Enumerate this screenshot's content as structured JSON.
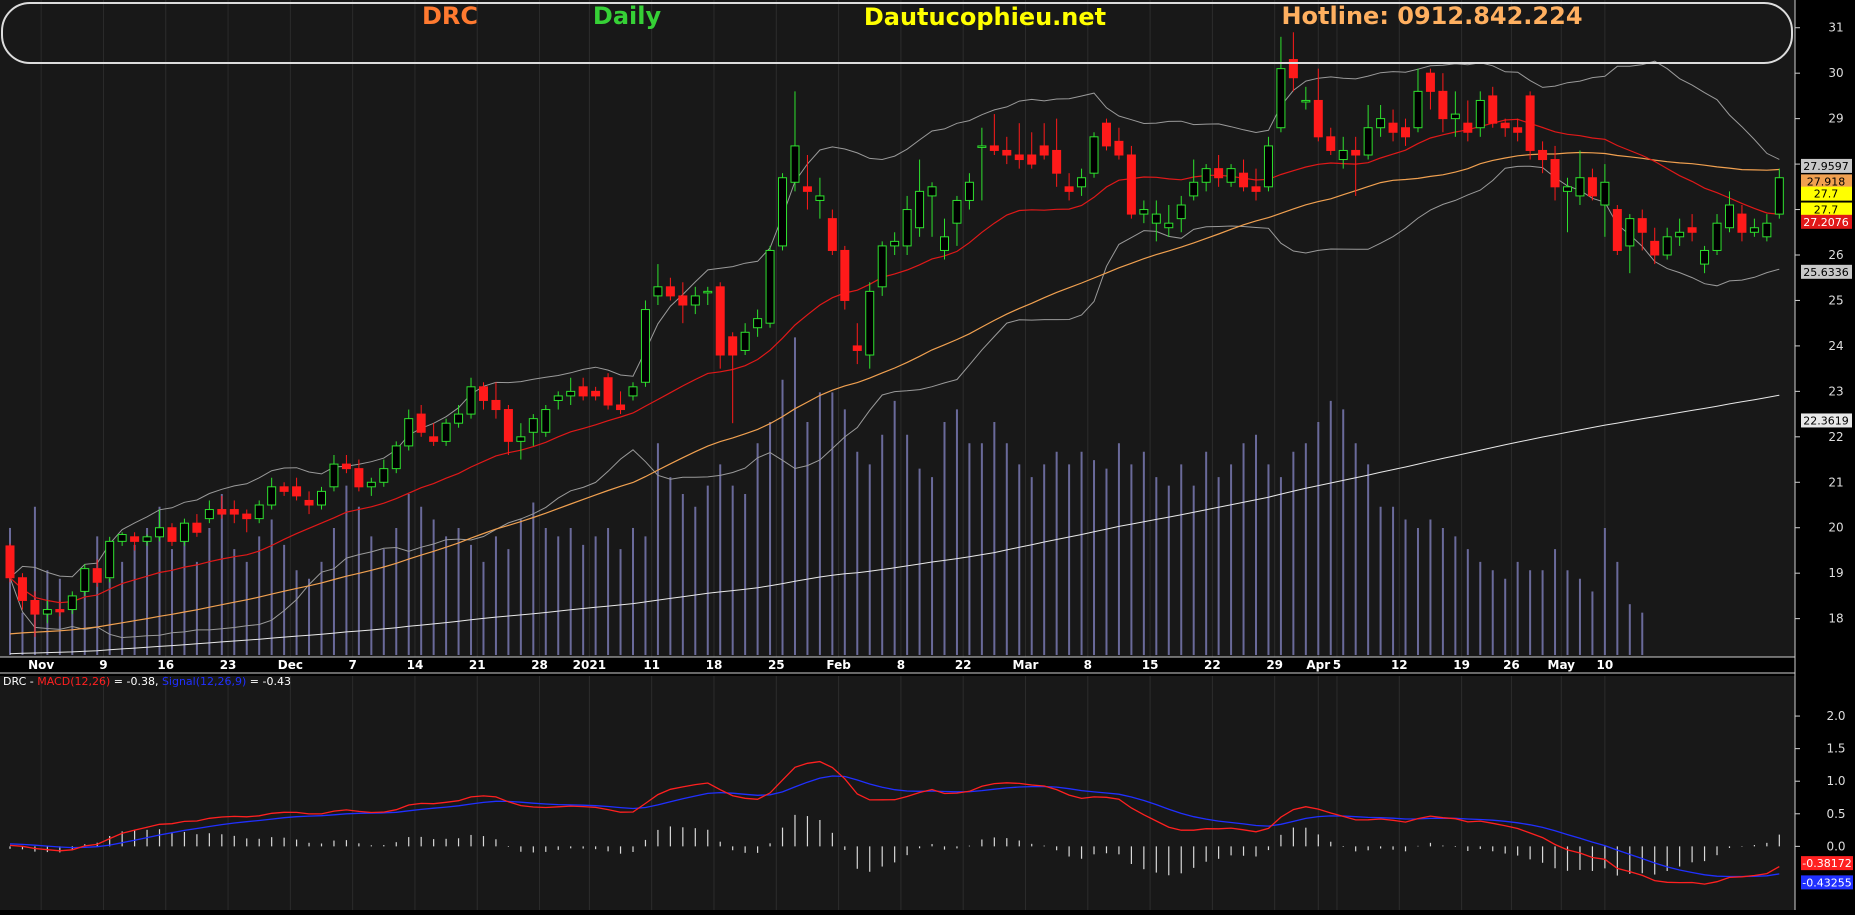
{
  "header": {
    "symbol": "DRC",
    "interval": "Daily",
    "site": "Dautucophieu.net",
    "hotline": "Hotline: 0912.842.224"
  },
  "colors": {
    "up": "#2ee02e",
    "down": "#ff1a1a",
    "ma_short": "#e01818",
    "ma_mid": "#f0a050",
    "ma_long": "#e8e8e8",
    "bands": "#9a9a9a",
    "volume": "#6a6a9a",
    "macd": "#ff2020",
    "signal": "#2030ff",
    "hist": "#d8d8d8",
    "symbol_color": "#ff7a30",
    "interval_color": "#36d036",
    "site_color": "#ffff00",
    "hotline_color": "#ffb060"
  },
  "chart_data": [
    {
      "type": "candlestick",
      "title": "",
      "ylim": [
        17.2,
        31.5
      ],
      "yticks": [
        "18",
        "19",
        "20",
        "21",
        "22",
        "23",
        "24",
        "25",
        "26",
        "27",
        "28",
        "29",
        "30",
        "31"
      ],
      "x_labels": [
        {
          "label": "Nov",
          "session": 2.5
        },
        {
          "label": "9",
          "session": 7.5
        },
        {
          "label": "16",
          "session": 12.5
        },
        {
          "label": "23",
          "session": 17.5
        },
        {
          "label": "Dec",
          "session": 22.5
        },
        {
          "label": "7",
          "session": 27.5
        },
        {
          "label": "14",
          "session": 32.5
        },
        {
          "label": "21",
          "session": 37.5
        },
        {
          "label": "28",
          "session": 42.5
        },
        {
          "label": "2021",
          "session": 46.5
        },
        {
          "label": "11",
          "session": 51.5
        },
        {
          "label": "18",
          "session": 56.5
        },
        {
          "label": "25",
          "session": 61.5
        },
        {
          "label": "Feb",
          "session": 66.5
        },
        {
          "label": "8",
          "session": 71.5
        },
        {
          "label": "22",
          "session": 76.5
        },
        {
          "label": "Mar",
          "session": 81.5
        },
        {
          "label": "8",
          "session": 86.5
        },
        {
          "label": "15",
          "session": 91.5
        },
        {
          "label": "22",
          "session": 96.5
        },
        {
          "label": "29",
          "session": 101.5
        },
        {
          "label": "Apr",
          "session": 105.0
        },
        {
          "label": "5",
          "session": 106.5
        },
        {
          "label": "12",
          "session": 111.5
        },
        {
          "label": "19",
          "session": 116.5
        },
        {
          "label": "26",
          "session": 120.5
        },
        {
          "label": "May",
          "session": 124.5
        },
        {
          "label": "10",
          "session": 128.0
        }
      ],
      "value_tags": [
        {
          "value": "27.9597",
          "color": "#c8c8c8",
          "text_color": "#000000",
          "y": 27.96
        },
        {
          "value": "27.918",
          "color": "#f0a050",
          "text_color": "#000000",
          "y": 27.62
        },
        {
          "value": "27.7",
          "color": "#ffff00",
          "text_color": "#000000",
          "y": 27.35
        },
        {
          "value": "27.7",
          "color": "#ffff00",
          "text_color": "#000000",
          "y": 27.0
        },
        {
          "value": "27.2076",
          "color": "#e01818",
          "text_color": "#ffffff",
          "y": 26.73
        },
        {
          "value": "25.6336",
          "color": "#c8c8c8",
          "text_color": "#000000",
          "y": 25.63
        },
        {
          "value": "22.3619",
          "color": "#e8e8e8",
          "text_color": "#000000",
          "y": 22.36
        }
      ],
      "candles": [
        [
          19.6,
          19.65,
          18.8,
          18.9
        ],
        [
          18.9,
          19.0,
          18.2,
          18.4
        ],
        [
          18.4,
          18.6,
          17.6,
          18.1
        ],
        [
          18.1,
          18.4,
          17.9,
          18.2
        ],
        [
          18.2,
          18.4,
          18.05,
          18.15
        ],
        [
          18.2,
          18.6,
          18.1,
          18.5
        ],
        [
          18.6,
          19.2,
          18.5,
          19.1
        ],
        [
          19.1,
          19.3,
          18.7,
          18.8
        ],
        [
          18.9,
          19.8,
          18.8,
          19.7
        ],
        [
          19.7,
          19.9,
          19.6,
          19.85
        ],
        [
          19.8,
          19.9,
          19.5,
          19.7
        ],
        [
          19.7,
          19.85,
          19.6,
          19.8
        ],
        [
          19.8,
          20.4,
          19.7,
          20.0
        ],
        [
          20.0,
          20.1,
          19.6,
          19.7
        ],
        [
          19.7,
          20.2,
          19.6,
          20.1
        ],
        [
          20.1,
          20.3,
          19.8,
          19.9
        ],
        [
          20.2,
          20.6,
          20.1,
          20.4
        ],
        [
          20.4,
          20.7,
          20.2,
          20.3
        ],
        [
          20.4,
          20.6,
          20.1,
          20.3
        ],
        [
          20.3,
          20.4,
          19.9,
          20.2
        ],
        [
          20.2,
          20.6,
          20.1,
          20.5
        ],
        [
          20.5,
          21.1,
          20.4,
          20.9
        ],
        [
          20.9,
          21.0,
          20.7,
          20.8
        ],
        [
          20.9,
          21.1,
          20.6,
          20.7
        ],
        [
          20.6,
          20.8,
          20.3,
          20.5
        ],
        [
          20.5,
          20.9,
          20.4,
          20.8
        ],
        [
          20.9,
          21.6,
          20.8,
          21.4
        ],
        [
          21.4,
          21.6,
          21.2,
          21.3
        ],
        [
          21.3,
          21.5,
          20.8,
          20.9
        ],
        [
          20.9,
          21.1,
          20.7,
          21.0
        ],
        [
          21.0,
          21.5,
          20.9,
          21.3
        ],
        [
          21.3,
          21.9,
          21.2,
          21.8
        ],
        [
          21.8,
          22.6,
          21.7,
          22.4
        ],
        [
          22.5,
          22.7,
          22.0,
          22.1
        ],
        [
          22.0,
          22.3,
          21.8,
          21.9
        ],
        [
          21.9,
          22.4,
          21.8,
          22.3
        ],
        [
          22.3,
          22.7,
          22.2,
          22.5
        ],
        [
          22.5,
          23.3,
          22.4,
          23.1
        ],
        [
          23.1,
          23.2,
          22.6,
          22.8
        ],
        [
          22.8,
          23.2,
          22.4,
          22.6
        ],
        [
          22.6,
          22.7,
          21.6,
          21.9
        ],
        [
          21.9,
          22.3,
          21.5,
          22.0
        ],
        [
          22.1,
          22.5,
          21.8,
          22.4
        ],
        [
          22.1,
          22.7,
          22.0,
          22.6
        ],
        [
          22.8,
          23.0,
          22.6,
          22.9
        ],
        [
          22.9,
          23.3,
          22.7,
          23.0
        ],
        [
          23.1,
          23.3,
          22.8,
          22.9
        ],
        [
          23.0,
          23.1,
          22.8,
          22.9
        ],
        [
          23.3,
          23.4,
          22.6,
          22.7
        ],
        [
          22.7,
          23.0,
          22.5,
          22.6
        ],
        [
          22.9,
          23.2,
          22.8,
          23.1
        ],
        [
          23.2,
          25.0,
          23.1,
          24.8
        ],
        [
          25.1,
          25.8,
          24.9,
          25.3
        ],
        [
          25.3,
          25.5,
          25.0,
          25.1
        ],
        [
          25.1,
          25.4,
          24.5,
          24.9
        ],
        [
          24.9,
          25.3,
          24.7,
          25.1
        ],
        [
          25.2,
          25.3,
          24.9,
          25.2
        ],
        [
          25.3,
          25.4,
          23.5,
          23.8
        ],
        [
          24.2,
          24.3,
          22.3,
          23.8
        ],
        [
          23.9,
          24.5,
          23.8,
          24.3
        ],
        [
          24.4,
          24.8,
          24.2,
          24.6
        ],
        [
          24.5,
          26.2,
          24.4,
          26.1
        ],
        [
          26.2,
          27.8,
          26.1,
          27.7
        ],
        [
          27.6,
          29.6,
          27.4,
          28.4
        ],
        [
          27.5,
          28.2,
          27.0,
          27.4
        ],
        [
          27.2,
          27.7,
          26.8,
          27.3
        ],
        [
          26.8,
          27.0,
          26.0,
          26.1
        ],
        [
          26.1,
          26.2,
          24.8,
          25.0
        ],
        [
          24.0,
          24.5,
          23.6,
          23.9
        ],
        [
          23.8,
          25.4,
          23.5,
          25.2
        ],
        [
          25.3,
          26.3,
          25.1,
          26.2
        ],
        [
          26.2,
          26.5,
          26.0,
          26.3
        ],
        [
          26.2,
          27.3,
          26.0,
          27.0
        ],
        [
          26.6,
          28.1,
          26.4,
          27.4
        ],
        [
          27.3,
          27.6,
          26.4,
          27.5
        ],
        [
          26.1,
          26.8,
          25.9,
          26.4
        ],
        [
          26.7,
          27.3,
          26.2,
          27.2
        ],
        [
          27.2,
          27.8,
          27.0,
          27.6
        ],
        [
          28.4,
          28.8,
          27.2,
          28.4
        ],
        [
          28.4,
          29.1,
          28.2,
          28.3
        ],
        [
          28.3,
          28.6,
          28.0,
          28.2
        ],
        [
          28.2,
          28.9,
          27.9,
          28.1
        ],
        [
          28.2,
          28.7,
          27.9,
          28.0
        ],
        [
          28.4,
          28.9,
          28.1,
          28.2
        ],
        [
          28.3,
          29.0,
          27.5,
          27.8
        ],
        [
          27.5,
          27.8,
          27.2,
          27.4
        ],
        [
          27.5,
          27.9,
          27.3,
          27.7
        ],
        [
          27.8,
          28.7,
          27.7,
          28.6
        ],
        [
          28.9,
          29.0,
          28.3,
          28.4
        ],
        [
          28.5,
          28.8,
          28.1,
          28.2
        ],
        [
          28.2,
          28.4,
          26.8,
          26.9
        ],
        [
          26.9,
          27.2,
          26.7,
          27.0
        ],
        [
          26.7,
          27.2,
          26.3,
          26.9
        ],
        [
          26.6,
          27.1,
          26.4,
          26.7
        ],
        [
          26.8,
          27.3,
          26.5,
          27.1
        ],
        [
          27.3,
          28.1,
          27.2,
          27.6
        ],
        [
          27.6,
          28.0,
          27.4,
          27.9
        ],
        [
          27.9,
          28.2,
          27.5,
          27.7
        ],
        [
          27.6,
          28.0,
          27.5,
          27.9
        ],
        [
          27.8,
          28.1,
          27.4,
          27.5
        ],
        [
          27.5,
          27.9,
          27.2,
          27.4
        ],
        [
          27.5,
          28.6,
          27.4,
          28.4
        ],
        [
          28.8,
          30.8,
          28.7,
          30.1
        ],
        [
          30.3,
          30.9,
          29.6,
          29.9
        ],
        [
          29.4,
          29.7,
          29.2,
          29.4
        ],
        [
          29.4,
          30.1,
          28.5,
          28.6
        ],
        [
          28.6,
          28.8,
          28.2,
          28.3
        ],
        [
          28.1,
          28.6,
          27.9,
          28.3
        ],
        [
          28.3,
          28.6,
          27.3,
          28.2
        ],
        [
          28.2,
          29.3,
          28.1,
          28.8
        ],
        [
          28.8,
          29.3,
          28.6,
          29.0
        ],
        [
          28.9,
          29.2,
          28.5,
          28.7
        ],
        [
          28.8,
          29.0,
          28.4,
          28.6
        ],
        [
          28.8,
          30.1,
          28.7,
          29.6
        ],
        [
          30.0,
          30.1,
          29.2,
          29.6
        ],
        [
          29.6,
          30.0,
          28.7,
          29.0
        ],
        [
          29.0,
          29.6,
          28.6,
          29.1
        ],
        [
          28.9,
          29.4,
          28.5,
          28.7
        ],
        [
          28.8,
          29.6,
          28.6,
          29.4
        ],
        [
          29.5,
          29.7,
          28.8,
          28.9
        ],
        [
          28.9,
          29.0,
          28.6,
          28.8
        ],
        [
          28.8,
          29.0,
          28.5,
          28.7
        ],
        [
          29.5,
          29.6,
          28.1,
          28.3
        ],
        [
          28.3,
          28.5,
          27.8,
          28.1
        ],
        [
          28.1,
          28.4,
          27.2,
          27.5
        ],
        [
          27.4,
          27.7,
          26.5,
          27.5
        ],
        [
          27.3,
          28.3,
          27.1,
          27.7
        ],
        [
          27.7,
          27.9,
          27.2,
          27.3
        ],
        [
          27.1,
          28.0,
          26.4,
          27.6
        ],
        [
          27.0,
          27.1,
          26.0,
          26.1
        ],
        [
          26.2,
          26.9,
          25.6,
          26.8
        ],
        [
          26.8,
          27.0,
          26.1,
          26.5
        ],
        [
          26.3,
          26.6,
          25.8,
          26.0
        ],
        [
          26.0,
          26.6,
          25.9,
          26.4
        ],
        [
          26.4,
          26.8,
          26.2,
          26.5
        ],
        [
          26.6,
          26.9,
          26.3,
          26.5
        ],
        [
          25.8,
          26.2,
          25.6,
          26.1
        ],
        [
          26.1,
          26.9,
          26.0,
          26.7
        ],
        [
          26.6,
          27.4,
          26.5,
          27.1
        ],
        [
          26.9,
          27.1,
          26.3,
          26.5
        ],
        [
          26.5,
          26.8,
          26.4,
          26.6
        ],
        [
          26.4,
          26.9,
          26.3,
          26.7
        ],
        [
          26.9,
          27.9,
          26.8,
          27.7
        ]
      ],
      "volume": [
        0.3,
        0.1,
        0.35,
        0.2,
        0.18,
        0.12,
        0.2,
        0.28,
        0.18,
        0.22,
        0.26,
        0.3,
        0.35,
        0.25,
        0.28,
        0.22,
        0.3,
        0.38,
        0.25,
        0.22,
        0.28,
        0.32,
        0.26,
        0.2,
        0.18,
        0.22,
        0.3,
        0.4,
        0.35,
        0.28,
        0.25,
        0.3,
        0.38,
        0.35,
        0.32,
        0.28,
        0.3,
        0.26,
        0.22,
        0.28,
        0.25,
        0.32,
        0.36,
        0.3,
        0.28,
        0.3,
        0.26,
        0.28,
        0.3,
        0.25,
        0.3,
        0.28,
        0.5,
        0.42,
        0.38,
        0.35,
        0.4,
        0.45,
        0.4,
        0.38,
        0.5,
        0.55,
        0.65,
        0.75,
        0.55,
        0.62,
        0.62,
        0.58,
        0.48,
        0.45,
        0.52,
        0.6,
        0.52,
        0.44,
        0.42,
        0.55,
        0.58,
        0.5,
        0.5,
        0.55,
        0.5,
        0.45,
        0.42,
        0.45,
        0.48,
        0.45,
        0.48,
        0.46,
        0.44,
        0.5,
        0.45,
        0.48,
        0.42,
        0.4,
        0.45,
        0.4,
        0.48,
        0.42,
        0.45,
        0.5,
        0.52,
        0.45,
        0.42,
        0.48,
        0.5,
        0.55,
        0.6,
        0.58,
        0.5,
        0.45,
        0.35,
        0.35,
        0.32,
        0.3,
        0.32,
        0.3,
        0.28,
        0.25,
        0.22,
        0.2,
        0.18,
        0.22,
        0.2,
        0.2,
        0.25,
        0.2,
        0.18,
        0.15,
        0.3,
        0.22,
        0.12,
        0.1
      ],
      "volume_max_display": 0.85
    },
    {
      "type": "line",
      "title": "",
      "label_prefix": "DRC - ",
      "macd_label": "MACD(12,26)",
      "macd_value_text": " = -0.38, ",
      "signal_label": "Signal(12,26,9)",
      "signal_value_text": " = -0.43",
      "ylim": [
        -0.9,
        2.4
      ],
      "yticks": [
        "1.0",
        "1.5",
        "0.5",
        "0.0",
        "2.0"
      ],
      "yticks_values": [
        1.0,
        1.5,
        0.5,
        0.0,
        2.0
      ],
      "value_tags": [
        {
          "value": "-0.38172",
          "color": "#ff2020",
          "y": -0.38
        },
        {
          "value": "-0.43255",
          "color": "#2030ff",
          "y": -0.43
        }
      ]
    }
  ]
}
